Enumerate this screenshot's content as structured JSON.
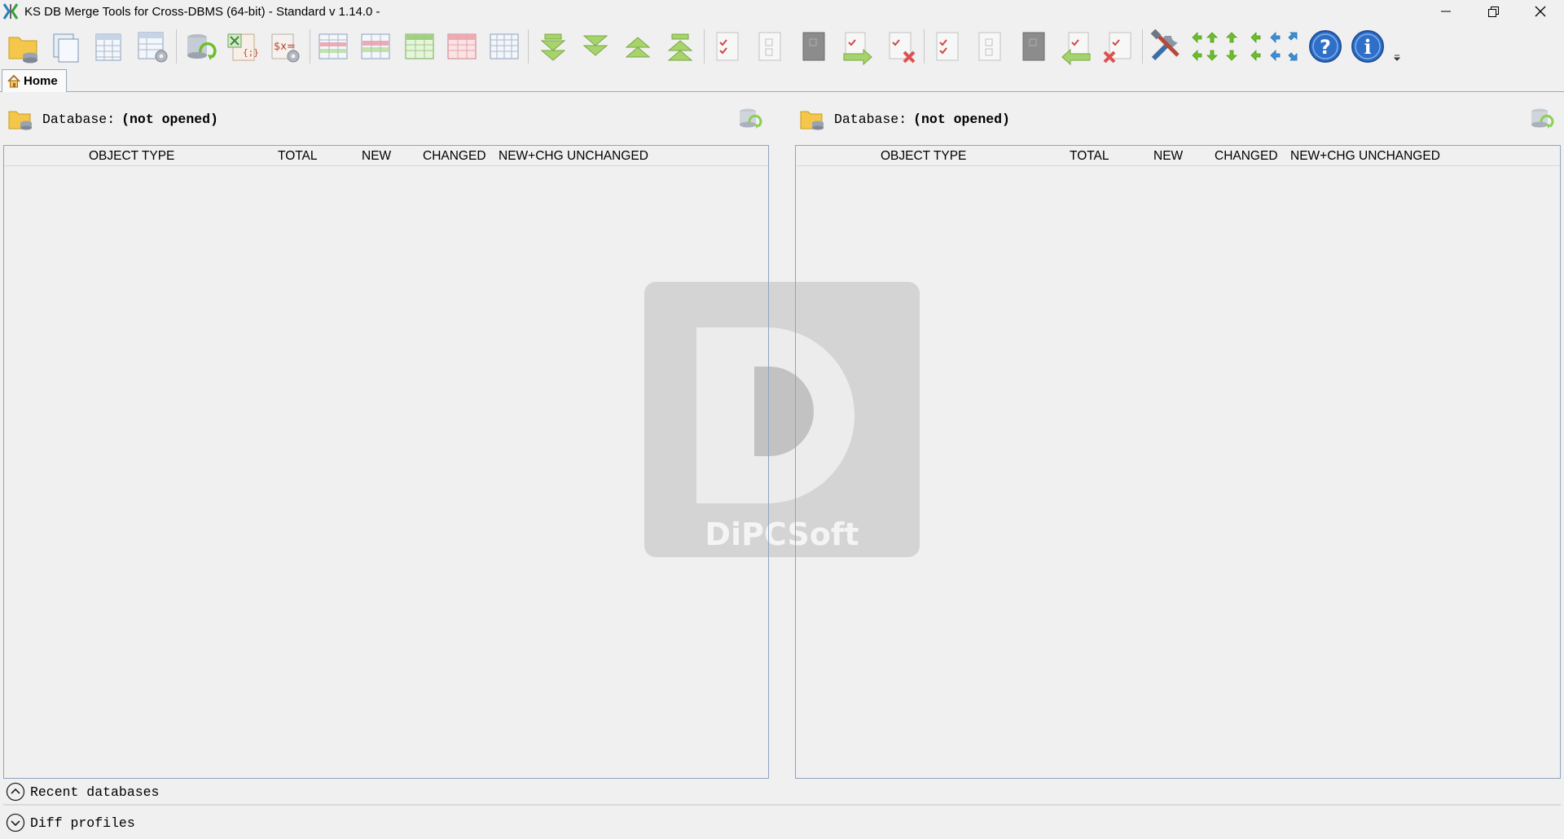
{
  "window": {
    "title": "KS DB Merge Tools for Cross-DBMS (64-bit) - Standard v 1.14.0 -"
  },
  "toolbar": {
    "icons": [
      "open-folder-icon",
      "copy-databases-icon",
      "sql-table-icon",
      "table-settings-icon",
      "refresh-compare-icon",
      "export-excel-icon",
      "script-settings-icon",
      "grid-all-icon",
      "grid-changed-icon",
      "grid-new-icon",
      "grid-deleted-icon",
      "grid-empty-icon",
      "expand-down-icon",
      "expand-down-2-icon",
      "collapse-up-icon",
      "collapse-up-2-icon",
      "check-doc-icon",
      "blank-doc-icon",
      "doc-dark-icon",
      "merge-right-icon",
      "delete-doc-icon",
      "check-doc-2-icon",
      "blank-doc-2-icon",
      "doc-dark-2-icon",
      "merge-left-icon",
      "delete-check-icon",
      "tools-icon",
      "nav-arrows-icon",
      "help-icon",
      "info-icon",
      "more-dropdown-icon"
    ]
  },
  "tabs": [
    {
      "label": "Home"
    }
  ],
  "left_panel": {
    "db_label": "Database:",
    "db_value": "(not opened)",
    "columns": [
      "OBJECT TYPE",
      "TOTAL",
      "NEW",
      "CHANGED",
      "NEW+CHG",
      "UNCHANGED"
    ]
  },
  "right_panel": {
    "db_label": "Database:",
    "db_value": "(not opened)",
    "columns": [
      "OBJECT TYPE",
      "TOTAL",
      "NEW",
      "CHANGED",
      "NEW+CHG",
      "UNCHANGED"
    ]
  },
  "watermark": {
    "letter": "D",
    "text": "DiPCSoft"
  },
  "bottom": {
    "recent_label": "Recent databases",
    "profiles_label": "Diff profiles"
  },
  "colors": {
    "accent_blue": "#2f6fc8",
    "green": "#6cbf2a",
    "grid_border": "#8ea3bf"
  }
}
